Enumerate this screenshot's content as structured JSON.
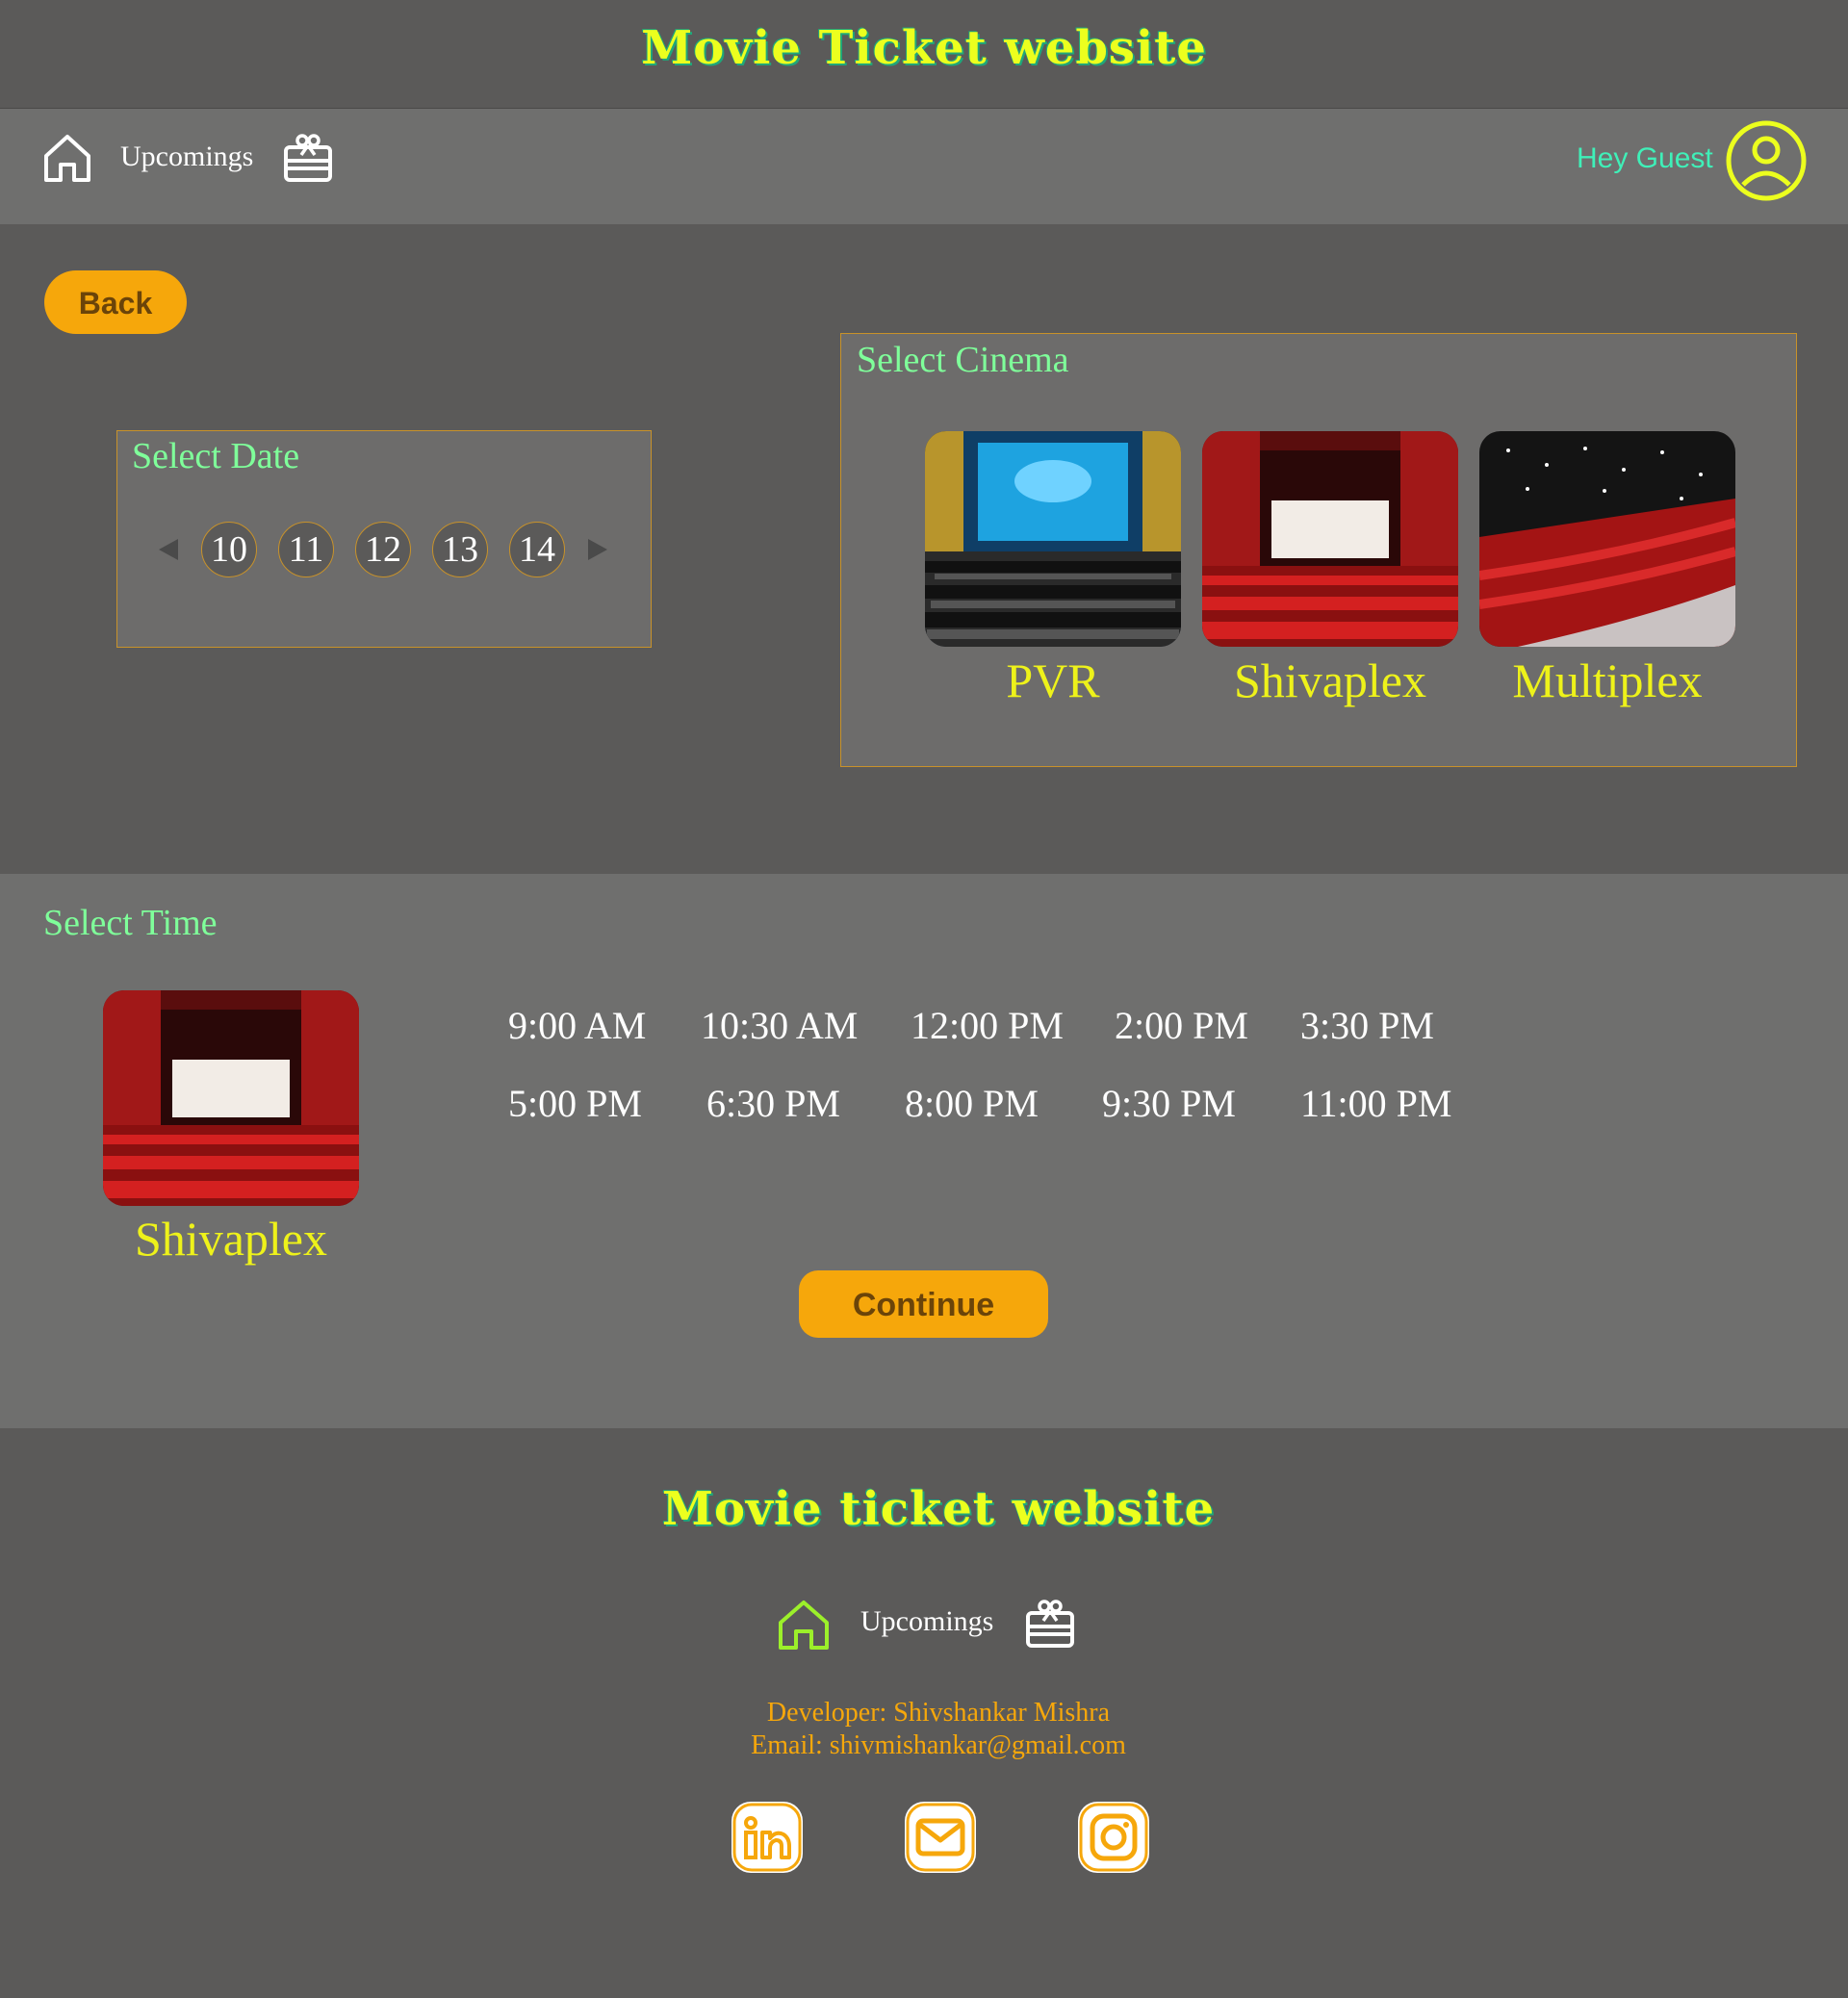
{
  "header": {
    "title": "Movie Ticket website"
  },
  "nav": {
    "home_icon": "home-icon",
    "upcomings_label": "Upcomings",
    "ticket_icon": "ticket-gift-icon",
    "greeting": "Hey Guest",
    "profile_icon": "user-circle-icon"
  },
  "back_label": "Back",
  "date_panel": {
    "heading": "Select Date",
    "dates": [
      "10",
      "11",
      "12",
      "13",
      "14"
    ]
  },
  "cinema_panel": {
    "heading": "Select Cinema",
    "cinemas": [
      {
        "name": "PVR"
      },
      {
        "name": "Shivaplex"
      },
      {
        "name": "Multiplex"
      }
    ]
  },
  "time_section": {
    "heading": "Select Time",
    "selected_cinema": "Shivaplex",
    "times_row1": [
      "9:00 AM",
      "10:30 AM",
      "12:00 PM",
      "2:00 PM",
      "3:30 PM"
    ],
    "times_row2": [
      "5:00 PM",
      "6:30 PM",
      "8:00 PM",
      "9:30 PM",
      "11:00 PM"
    ],
    "continue_label": "Continue"
  },
  "footer": {
    "title": "Movie ticket website",
    "upcomings_label": "Upcomings",
    "developer": "Developer: Shivshankar Mishra",
    "email": "Email: shivmishankar@gmail.com",
    "socials": [
      "linkedin-icon",
      "mail-icon",
      "instagram-icon"
    ]
  },
  "colors": {
    "accent": "#f6a70b",
    "title_yellow": "#ecff1e",
    "heading_green": "#7fff9a",
    "cinema_name_yellow": "#eef21a",
    "greeting_teal": "#3ff0b8"
  }
}
